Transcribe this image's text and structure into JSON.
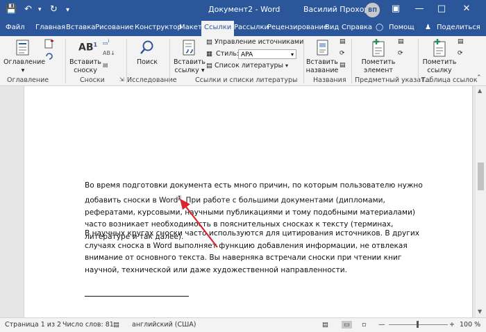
{
  "title_bar": {
    "doc_title": "Документ2 - Word",
    "user_name": "Василий Прохоров",
    "avatar_initials": "ВП"
  },
  "tabs": [
    "Файл",
    "Главная",
    "Вставка",
    "Рисование",
    "Конструктор",
    "Макет",
    "Ссылки",
    "Рассылки",
    "Рецензирование",
    "Вид",
    "Справка"
  ],
  "tab_extras": {
    "help_search": "Помощ",
    "share": "Поделиться"
  },
  "ribbon": {
    "toc": {
      "button": "Оглавление",
      "group": "Оглавление"
    },
    "footnotes": {
      "button_line1": "Вставить",
      "button_line2": "сноску",
      "group": "Сноски"
    },
    "research": {
      "button": "Поиск",
      "group": "Исследование"
    },
    "citations": {
      "button_line1": "Вставить",
      "button_line2": "ссылку",
      "manage_sources": "Управление источниками",
      "style_label": "Стиль:",
      "style_value": "APA",
      "bibliography": "Список литературы",
      "group": "Ссылки и списки литературы"
    },
    "captions": {
      "button_line1": "Вставить",
      "button_line2": "название",
      "group": "Названия"
    },
    "index": {
      "button_line1": "Пометить",
      "button_line2": "элемент",
      "group": "Предметный указат..."
    },
    "authorities": {
      "button_line1": "Пометить",
      "button_line2": "ссылку",
      "group": "Таблица ссылок"
    }
  },
  "document": {
    "para1_before": "Во время подготовки документа есть много причин, по которым пользователю нужно добавить сноски в Word",
    "footnote_mark": "1",
    "para1_after": ". При работе с большими документами (дипломами, рефератами, курсовыми, научными публикациями и тому подобными материалами) часто возникает необходимость в пояснительных сносках к тексту (терминах, литературе и так далее).",
    "para2": "В научных кругах сноски часто используются для цитирования источников. В других случаях сноска в Word выполняет функцию добавления информации, не отвлекая внимание от основного текста. Вы наверняка встречали сноски при чтении книг научной, технической или даже художественной направленности."
  },
  "status_bar": {
    "page": "Страница 1 из 2",
    "words": "Число слов: 81",
    "language": "английский (США)",
    "zoom": "100 %"
  },
  "colors": {
    "accent": "#2b579a",
    "arrow": "#d9252b"
  }
}
